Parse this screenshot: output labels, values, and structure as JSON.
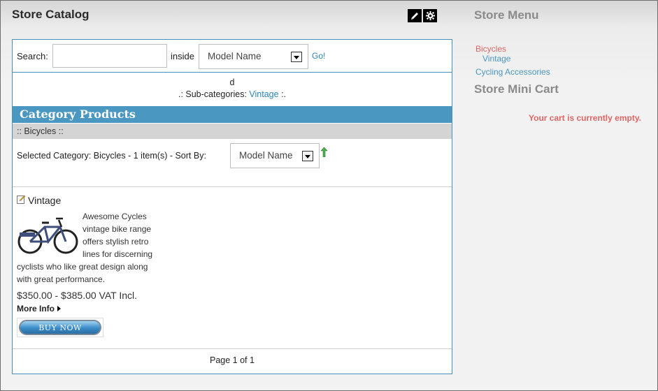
{
  "catalog": {
    "title": "Store Catalog",
    "search": {
      "label": "Search:",
      "value": "",
      "placeholder": "",
      "inside_label": "inside",
      "field_select": "Model Name",
      "go_label": "Go!"
    },
    "description": "d",
    "subcategories": {
      "prefix": ".: Sub-categories:",
      "link": "Vintage",
      "suffix": ":."
    },
    "category_header": "Category Products",
    "category_band": ":: Bicycles ::",
    "sort": {
      "text": "Selected Category: Bicycles - 1 item(s) - Sort By:",
      "select": "Model Name"
    },
    "product": {
      "name": "Vintage",
      "description": "Awesome Cycles vintage bike range offers stylish retro lines for discerning cyclists who like great design along with great performance.",
      "price": "$350.00 - $385.00 VAT Incl.",
      "more_info": "More Info",
      "buy_label": "BUY NOW"
    },
    "pager": "Page 1 of 1"
  },
  "sidebar": {
    "menu_title": "Store Menu",
    "menu_items": [
      "Bicycles",
      "Vintage",
      "Cycling Accessories"
    ],
    "cart_title": "Store Mini Cart",
    "cart_empty": "Your cart is currently empty."
  },
  "colors": {
    "accent": "#4a97c1",
    "link": "#2c83b8",
    "alert": "#e06666"
  },
  "icons": [
    "pencil-icon",
    "gear-icon",
    "edit-icon",
    "sort-up-arrow-icon",
    "triangle-right-icon"
  ]
}
